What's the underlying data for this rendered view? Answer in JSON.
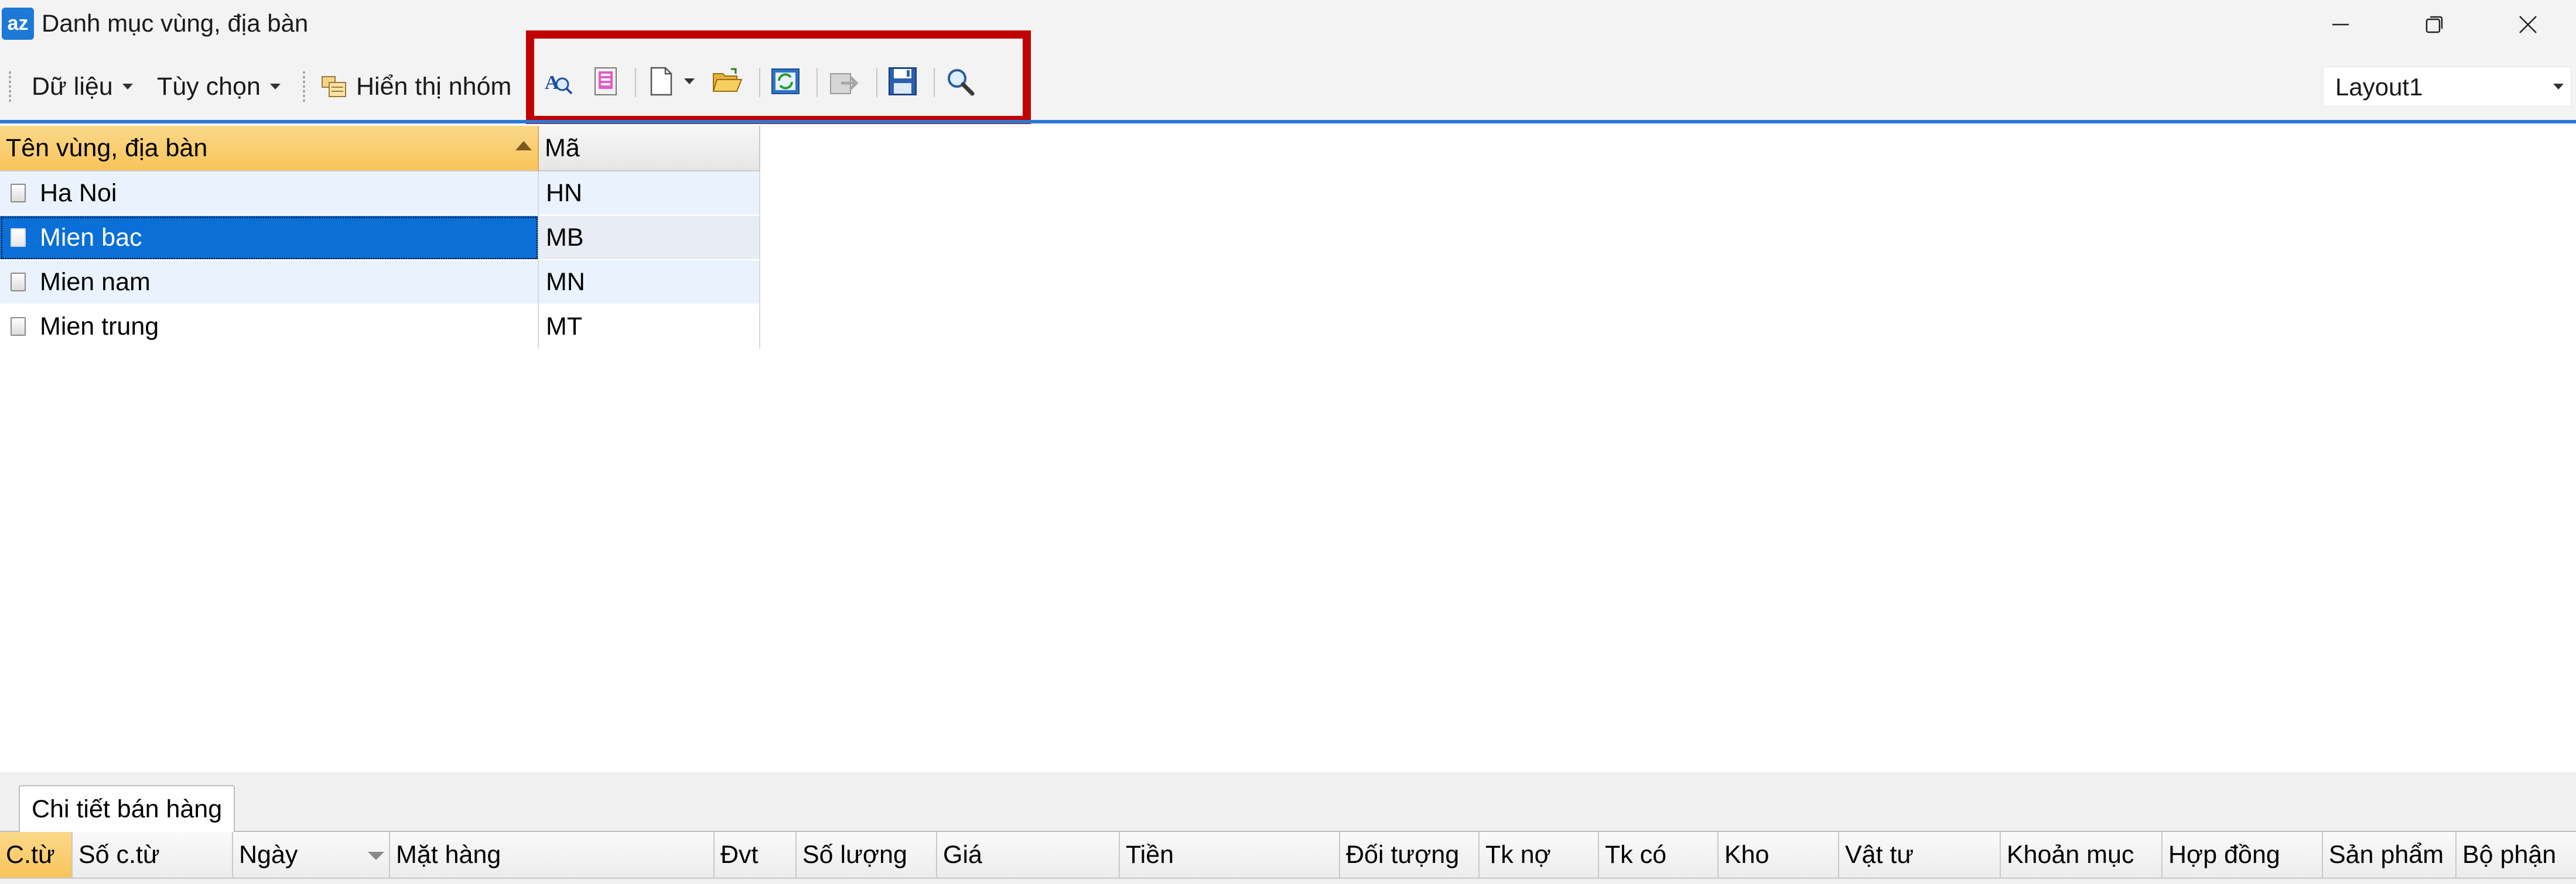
{
  "window": {
    "icon_text": "az",
    "title": "Danh mục vùng, địa bàn"
  },
  "toolbar": {
    "menu_data": "Dữ liệu",
    "menu_options": "Tùy chọn",
    "group_label": "Hiển thị nhóm",
    "icons": [
      "find-replace-icon",
      "edit-doc-icon",
      "new-doc-icon",
      "open-folder-icon",
      "refresh-icon",
      "export-icon",
      "save-icon",
      "search-icon"
    ],
    "highlight_color": "#c00000"
  },
  "layout": {
    "selected": "Layout1"
  },
  "grid": {
    "columns": [
      "Tên vùng, địa bàn",
      "Mã"
    ],
    "sorted_column": "Tên vùng, địa bàn",
    "rows": [
      {
        "name": "Ha Noi",
        "code": "HN"
      },
      {
        "name": "Mien bac",
        "code": "MB"
      },
      {
        "name": "Mien nam",
        "code": "MN"
      },
      {
        "name": "Mien trung",
        "code": "MT"
      }
    ],
    "selected_row": "Mien bac",
    "selection_color": "#0a6fd6"
  },
  "detail": {
    "tab_label": "Chi tiết bán hàng",
    "columns": [
      "C.từ",
      "Số c.từ",
      "Ngày",
      "Mặt hàng",
      "Đvt",
      "Số lượng",
      "Giá",
      "Tiền",
      "Đối tượng",
      "Tk nợ",
      "Tk có",
      "Kho",
      "Vật tư",
      "Khoản mục",
      "Hợp đồng",
      "Sản phẩm",
      "Bộ phận"
    ]
  }
}
